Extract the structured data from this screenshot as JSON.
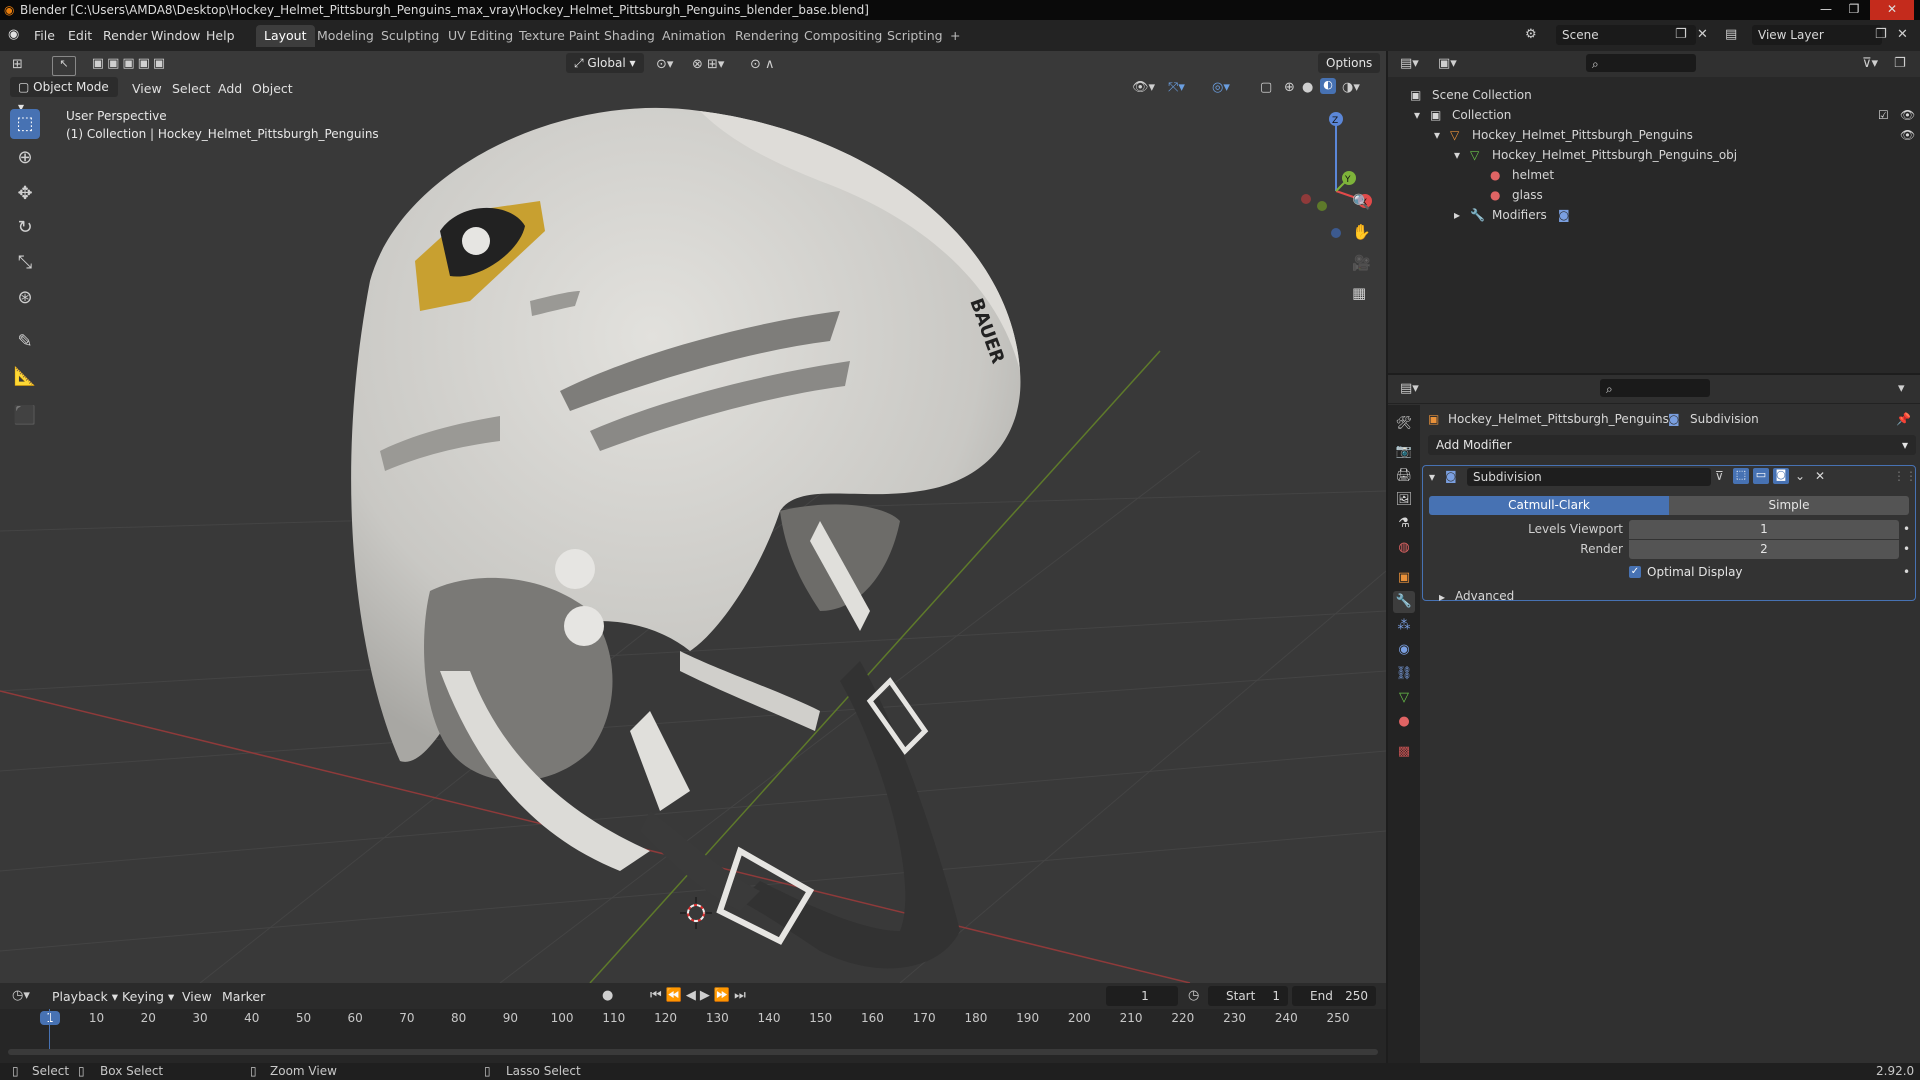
{
  "titlebar": {
    "title": "Blender [C:\\Users\\AMDA8\\Desktop\\Hockey_Helmet_Pittsburgh_Penguins_max_vray\\Hockey_Helmet_Pittsburgh_Penguins_blender_base.blend]",
    "minimize": "—",
    "maximize": "❐",
    "close": "✕"
  },
  "menu": {
    "file": "File",
    "edit": "Edit",
    "render": "Render",
    "window": "Window",
    "help": "Help"
  },
  "workspaces": [
    "Layout",
    "Modeling",
    "Sculpting",
    "UV Editing",
    "Texture Paint",
    "Shading",
    "Animation",
    "Rendering",
    "Compositing",
    "Scripting"
  ],
  "workspace_add": "+",
  "scene": {
    "scene_name": "Scene",
    "view_layer": "View Layer"
  },
  "viewport_header": {
    "orientation": "Global",
    "options": "Options",
    "mode": "Object Mode",
    "view": "View",
    "select": "Select",
    "add": "Add",
    "object": "Object"
  },
  "viewport_info": {
    "line1": "User Perspective",
    "line2": "(1) Collection | Hockey_Helmet_Pittsburgh_Penguins"
  },
  "gizmo": {
    "x": "X",
    "y": "Y",
    "z": "Z"
  },
  "helmet_logo_text": "BAUER",
  "outliner": {
    "root": "Scene Collection",
    "collection": "Collection",
    "object": "Hockey_Helmet_Pittsburgh_Penguins",
    "mesh": "Hockey_Helmet_Pittsburgh_Penguins_obj",
    "mat1": "helmet",
    "mat2": "glass",
    "modifiers": "Modifiers"
  },
  "properties": {
    "object_name": "Hockey_Helmet_Pittsburgh_Penguins",
    "modifier_crumb": "Subdivision",
    "add_modifier": "Add Modifier",
    "modifier_name": "Subdivision",
    "catmull": "Catmull-Clark",
    "simple": "Simple",
    "levels_viewport_label": "Levels Viewport",
    "levels_viewport_value": "1",
    "render_label": "Render",
    "render_value": "2",
    "optimal_display": "Optimal Display",
    "advanced": "Advanced"
  },
  "timeline": {
    "playback": "Playback",
    "keying": "Keying",
    "view": "View",
    "marker": "Marker",
    "current_frame": "1",
    "start_label": "Start",
    "start_value": "1",
    "end_label": "End",
    "end_value": "250",
    "ticks": [
      "1",
      "10",
      "20",
      "30",
      "40",
      "50",
      "60",
      "70",
      "80",
      "90",
      "100",
      "110",
      "120",
      "130",
      "140",
      "150",
      "160",
      "170",
      "180",
      "190",
      "200",
      "210",
      "220",
      "230",
      "240",
      "250"
    ]
  },
  "status": {
    "select": "Select",
    "box_select": "Box Select",
    "zoom_view": "Zoom View",
    "lasso_select": "Lasso Select",
    "version": "2.92.0"
  },
  "colors": {
    "accent": "#4772b3",
    "viewport_bg": "#393939",
    "helmet": "#d2d1cd"
  }
}
